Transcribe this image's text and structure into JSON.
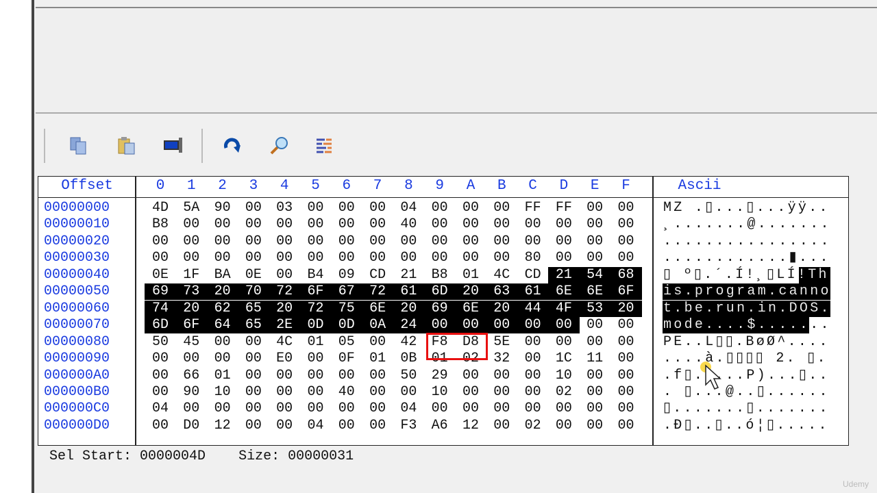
{
  "header": {
    "offset": "Offset",
    "columns": [
      "0",
      "1",
      "2",
      "3",
      "4",
      "5",
      "6",
      "7",
      "8",
      "9",
      "A",
      "B",
      "C",
      "D",
      "E",
      "F"
    ],
    "ascii": "Ascii"
  },
  "toolbar": [
    {
      "icon": "copy-icon"
    },
    {
      "icon": "paste-icon"
    },
    {
      "icon": "screen-capture-icon"
    },
    {
      "icon": "redo-icon"
    },
    {
      "icon": "find-icon"
    },
    {
      "icon": "compare-icon"
    }
  ],
  "rows": [
    {
      "offset": "00000000",
      "bytes": [
        "4D",
        "5A",
        "90",
        "00",
        "03",
        "00",
        "00",
        "00",
        "04",
        "00",
        "00",
        "00",
        "FF",
        "FF",
        "00",
        "00"
      ],
      "ascii": "MZ .▯...▯...ÿÿ.."
    },
    {
      "offset": "00000010",
      "bytes": [
        "B8",
        "00",
        "00",
        "00",
        "00",
        "00",
        "00",
        "00",
        "40",
        "00",
        "00",
        "00",
        "00",
        "00",
        "00",
        "00"
      ],
      "ascii": "¸.......@......."
    },
    {
      "offset": "00000020",
      "bytes": [
        "00",
        "00",
        "00",
        "00",
        "00",
        "00",
        "00",
        "00",
        "00",
        "00",
        "00",
        "00",
        "00",
        "00",
        "00",
        "00"
      ],
      "ascii": "................"
    },
    {
      "offset": "00000030",
      "bytes": [
        "00",
        "00",
        "00",
        "00",
        "00",
        "00",
        "00",
        "00",
        "00",
        "00",
        "00",
        "00",
        "80",
        "00",
        "00",
        "00"
      ],
      "ascii": "............▮..."
    },
    {
      "offset": "00000040",
      "bytes": [
        "0E",
        "1F",
        "BA",
        "0E",
        "00",
        "B4",
        "09",
        "CD",
        "21",
        "B8",
        "01",
        "4C",
        "CD",
        "21",
        "54",
        "68"
      ],
      "ascii": "▯ º▯.´.Í!¸▯LÍ!Th"
    },
    {
      "offset": "00000050",
      "bytes": [
        "69",
        "73",
        "20",
        "70",
        "72",
        "6F",
        "67",
        "72",
        "61",
        "6D",
        "20",
        "63",
        "61",
        "6E",
        "6E",
        "6F"
      ],
      "ascii": "is.program.canno"
    },
    {
      "offset": "00000060",
      "bytes": [
        "74",
        "20",
        "62",
        "65",
        "20",
        "72",
        "75",
        "6E",
        "20",
        "69",
        "6E",
        "20",
        "44",
        "4F",
        "53",
        "20"
      ],
      "ascii": "t.be.run.in.DOS."
    },
    {
      "offset": "00000070",
      "bytes": [
        "6D",
        "6F",
        "64",
        "65",
        "2E",
        "0D",
        "0D",
        "0A",
        "24",
        "00",
        "00",
        "00",
        "00",
        "00",
        "00",
        "00"
      ],
      "ascii": "mode....$......."
    },
    {
      "offset": "00000080",
      "bytes": [
        "50",
        "45",
        "00",
        "00",
        "4C",
        "01",
        "05",
        "00",
        "42",
        "F8",
        "D8",
        "5E",
        "00",
        "00",
        "00",
        "00"
      ],
      "ascii": "PE..L▯▯.BøØ^...."
    },
    {
      "offset": "00000090",
      "bytes": [
        "00",
        "00",
        "00",
        "00",
        "E0",
        "00",
        "0F",
        "01",
        "0B",
        "01",
        "02",
        "32",
        "00",
        "1C",
        "11",
        "00"
      ],
      "ascii": "....à.▯▯▯▯ 2. ▯."
    },
    {
      "offset": "000000A0",
      "bytes": [
        "00",
        "66",
        "01",
        "00",
        "00",
        "00",
        "00",
        "00",
        "50",
        "29",
        "00",
        "00",
        "00",
        "10",
        "00",
        "00"
      ],
      "ascii": ".f▯.....P)...▯.."
    },
    {
      "offset": "000000B0",
      "bytes": [
        "00",
        "90",
        "10",
        "00",
        "00",
        "00",
        "40",
        "00",
        "00",
        "10",
        "00",
        "00",
        "00",
        "02",
        "00",
        "00"
      ],
      "ascii": ". ▯...@..▯......"
    },
    {
      "offset": "000000C0",
      "bytes": [
        "04",
        "00",
        "00",
        "00",
        "00",
        "00",
        "00",
        "00",
        "04",
        "00",
        "00",
        "00",
        "00",
        "00",
        "00",
        "00"
      ],
      "ascii": "▯.......▯......."
    },
    {
      "offset": "000000D0",
      "bytes": [
        "00",
        "D0",
        "12",
        "00",
        "00",
        "04",
        "00",
        "00",
        "F3",
        "A6",
        "12",
        "00",
        "02",
        "00",
        "00",
        "00"
      ],
      "ascii": ".Ð▯..▯..ó¦▯....."
    }
  ],
  "selection": {
    "start_index": 77,
    "length": 49
  },
  "status": {
    "sel_start_label": "Sel Start:",
    "sel_start_value": "0000004D",
    "size_label": "Size:",
    "size_value": "00000031"
  },
  "watermark": "Udemy",
  "colors": {
    "offset_blue": "#1a3be0",
    "highlight_red": "#e81010",
    "selection": "#000000"
  }
}
